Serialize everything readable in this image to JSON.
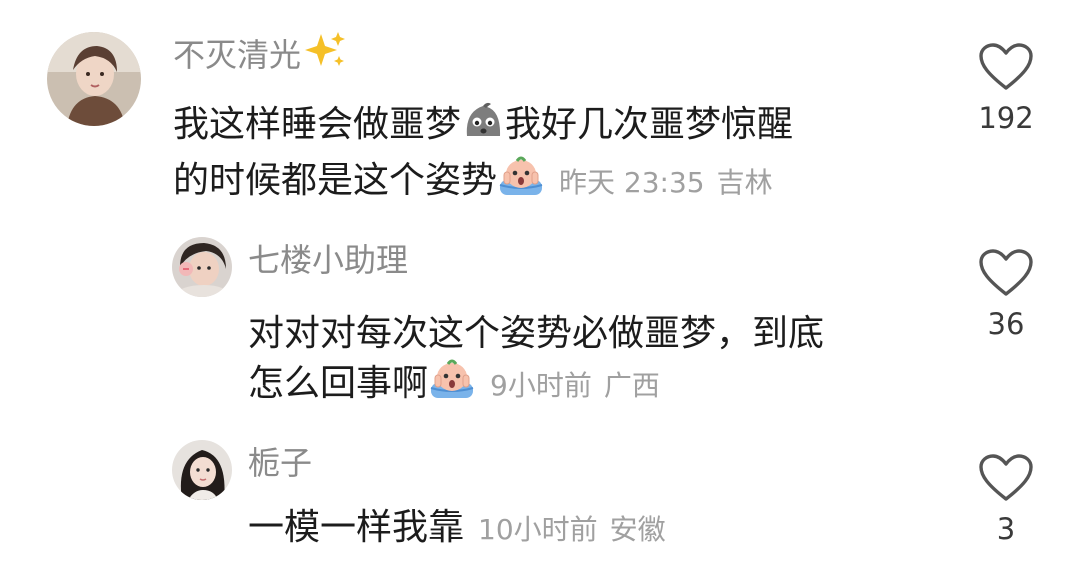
{
  "comments": [
    {
      "username": "不灭清光",
      "username_emoji": "sparkles-emoji",
      "text_part1": "我这样睡会做噩梦",
      "inline_emoji1": "sad-gray-face-emoji",
      "text_part2": "我好几次噩梦惊醒",
      "text_line2": "的时候都是这个姿势",
      "inline_emoji2": "scared-face-emoji",
      "time": "昨天 23:35",
      "location": "吉林",
      "likes": "192",
      "like_icon": "heart-outline-icon"
    },
    {
      "username": "七楼小助理",
      "text_line1": "对对对每次这个姿势必做噩梦，到底",
      "text_line2": "怎么回事啊",
      "inline_emoji": "scared-face-emoji",
      "time": "9小时前",
      "location": "广西",
      "likes": "36",
      "like_icon": "heart-outline-icon"
    },
    {
      "username": "栀子",
      "text": "一模一样我靠",
      "time": "10小时前",
      "location": "安徽",
      "likes": "3",
      "like_icon": "heart-outline-icon"
    }
  ]
}
